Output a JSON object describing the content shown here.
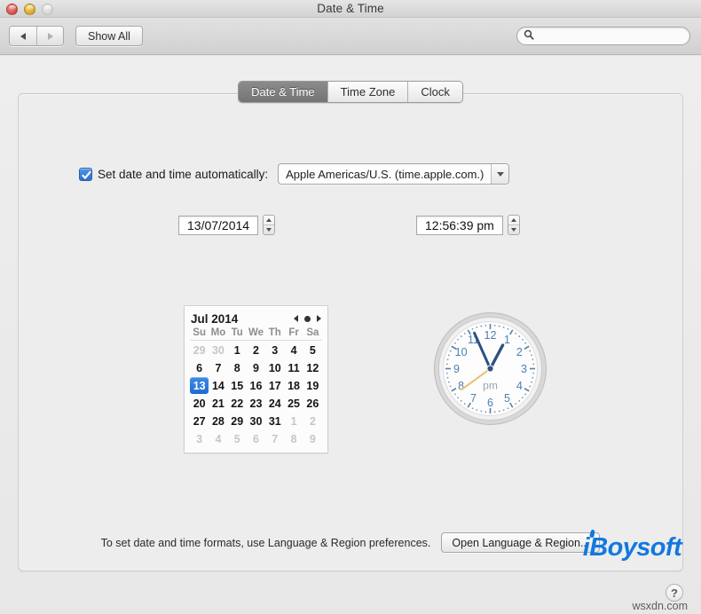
{
  "window": {
    "title": "Date & Time",
    "traffic_lights": [
      "close-button",
      "minimize-button",
      "zoom-button"
    ]
  },
  "toolbar": {
    "back_icon": "arrow-left-icon",
    "forward_icon": "arrow-right-icon",
    "show_all_label": "Show All",
    "search_icon": "search-icon",
    "search_value": "",
    "search_placeholder": ""
  },
  "tabs": [
    {
      "label": "Date & Time",
      "active": true
    },
    {
      "label": "Time Zone",
      "active": false
    },
    {
      "label": "Clock",
      "active": false
    }
  ],
  "auto_row": {
    "checkbox_checked": true,
    "label": "Set date and time automatically:",
    "server_value": "Apple Americas/U.S. (time.apple.com.)",
    "dropdown_icon": "chevron-down-icon"
  },
  "date_field": {
    "value": "13/07/2014",
    "stepper_up_icon": "stepper-up-icon",
    "stepper_down_icon": "stepper-down-icon"
  },
  "time_field": {
    "value": "12:56:39 pm",
    "stepper_up_icon": "stepper-up-icon",
    "stepper_down_icon": "stepper-down-icon"
  },
  "calendar": {
    "month_label": "Jul 2014",
    "nav": {
      "prev_icon": "triangle-left-icon",
      "today_icon": "dot-icon",
      "next_icon": "triangle-right-icon"
    },
    "weekdays": [
      "Su",
      "Mo",
      "Tu",
      "We",
      "Th",
      "Fr",
      "Sa"
    ],
    "selected_day": 13,
    "weeks": [
      [
        {
          "n": "29",
          "out": true
        },
        {
          "n": "30",
          "out": true
        },
        {
          "n": "1",
          "out": false
        },
        {
          "n": "2",
          "out": false
        },
        {
          "n": "3",
          "out": false
        },
        {
          "n": "4",
          "out": false
        },
        {
          "n": "5",
          "out": false
        }
      ],
      [
        {
          "n": "6",
          "out": false
        },
        {
          "n": "7",
          "out": false
        },
        {
          "n": "8",
          "out": false
        },
        {
          "n": "9",
          "out": false
        },
        {
          "n": "10",
          "out": false
        },
        {
          "n": "11",
          "out": false
        },
        {
          "n": "12",
          "out": false
        }
      ],
      [
        {
          "n": "13",
          "out": false,
          "sel": true
        },
        {
          "n": "14",
          "out": false
        },
        {
          "n": "15",
          "out": false
        },
        {
          "n": "16",
          "out": false
        },
        {
          "n": "17",
          "out": false
        },
        {
          "n": "18",
          "out": false
        },
        {
          "n": "19",
          "out": false
        }
      ],
      [
        {
          "n": "20",
          "out": false
        },
        {
          "n": "21",
          "out": false
        },
        {
          "n": "22",
          "out": false
        },
        {
          "n": "23",
          "out": false
        },
        {
          "n": "24",
          "out": false
        },
        {
          "n": "25",
          "out": false
        },
        {
          "n": "26",
          "out": false
        }
      ],
      [
        {
          "n": "27",
          "out": false
        },
        {
          "n": "28",
          "out": false
        },
        {
          "n": "29",
          "out": false
        },
        {
          "n": "30",
          "out": false
        },
        {
          "n": "31",
          "out": false
        },
        {
          "n": "1",
          "out": true
        },
        {
          "n": "2",
          "out": true
        }
      ],
      [
        {
          "n": "3",
          "out": true
        },
        {
          "n": "4",
          "out": true
        },
        {
          "n": "5",
          "out": true
        },
        {
          "n": "6",
          "out": true
        },
        {
          "n": "7",
          "out": true
        },
        {
          "n": "8",
          "out": true
        },
        {
          "n": "9",
          "out": true
        }
      ]
    ]
  },
  "clock": {
    "meridiem_label": "pm",
    "hour_numerals": [
      "12",
      "1",
      "2",
      "3",
      "4",
      "5",
      "6",
      "7",
      "8",
      "9",
      "10",
      "11"
    ],
    "hour_angle_deg": 388,
    "minute_angle_deg": 336,
    "second_angle_deg": 234,
    "numeral_color": "#4a7fb5",
    "second_hand_color": "#e8c170",
    "hand_color": "#2f4f7f"
  },
  "footer": {
    "note": "To set date and time formats, use Language & Region preferences.",
    "open_language_label": "Open Language & Region...",
    "help_label": "?"
  },
  "watermarks": {
    "brand": "iBoysoft",
    "site": "wsxdn.com",
    "brand_color": "#1378e0"
  }
}
